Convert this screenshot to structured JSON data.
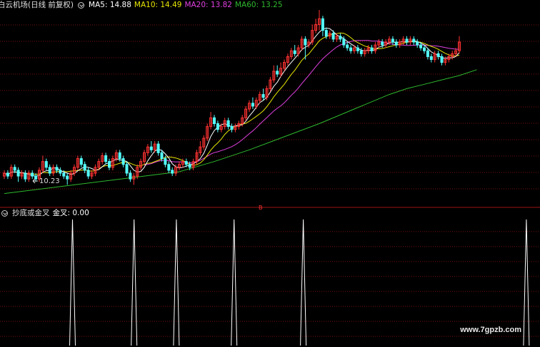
{
  "header": {
    "title": "白云机场(日线 前复权)",
    "ma5_label": "MA5: 14.88",
    "ma10_label": "MA10: 14.49",
    "ma20_label": "MA20: 13.82",
    "ma60_label": "MA60: 13.25"
  },
  "indicator": {
    "title": "抄底或金叉",
    "value_label": "金叉: 0.00"
  },
  "annotations": {
    "low_price": "10.23",
    "marker": "B"
  },
  "watermark": "www.7gpzb.com",
  "colors": {
    "background": "#000000",
    "grid": "#7a1010",
    "separator": "#a01414",
    "up_candle": "#ff3232",
    "down_candle": "#54ffff",
    "ma5": "#ffffff",
    "ma10": "#e6e600",
    "ma20": "#e040e0",
    "ma60": "#2eb82e",
    "signal": "#ffffff"
  },
  "chart_data": {
    "type": "candlestick",
    "price_range": [
      9.6,
      16.3
    ],
    "low_marker_price": 10.23,
    "candles": [
      [
        10.6,
        10.7,
        10.5,
        10.8
      ],
      [
        10.7,
        10.6,
        10.5,
        10.8
      ],
      [
        10.6,
        10.9,
        10.5,
        11.0
      ],
      [
        10.9,
        10.8,
        10.7,
        11.0
      ],
      [
        10.8,
        10.6,
        10.4,
        10.9
      ],
      [
        10.6,
        10.7,
        10.5,
        10.8
      ],
      [
        10.7,
        10.5,
        10.4,
        10.8
      ],
      [
        10.5,
        10.7,
        10.4,
        10.8
      ],
      [
        10.7,
        10.6,
        10.5,
        10.8
      ],
      [
        10.6,
        10.5,
        10.4,
        10.7
      ],
      [
        10.5,
        10.8,
        10.4,
        10.9
      ],
      [
        10.8,
        11.1,
        10.7,
        11.3
      ],
      [
        11.1,
        10.9,
        10.8,
        11.2
      ],
      [
        10.9,
        10.7,
        10.6,
        11.0
      ],
      [
        10.7,
        10.9,
        10.6,
        11.0
      ],
      [
        10.9,
        10.8,
        10.7,
        11.0
      ],
      [
        10.8,
        10.7,
        10.6,
        10.9
      ],
      [
        10.7,
        10.6,
        10.5,
        10.8
      ],
      [
        10.6,
        10.5,
        10.3,
        10.7
      ],
      [
        10.5,
        10.7,
        10.4,
        10.8
      ],
      [
        10.7,
        10.9,
        10.6,
        11.0
      ],
      [
        10.9,
        11.2,
        10.8,
        11.3
      ],
      [
        11.2,
        11.0,
        10.9,
        11.3
      ],
      [
        11.0,
        10.8,
        10.7,
        11.1
      ],
      [
        10.8,
        10.6,
        10.5,
        10.9
      ],
      [
        10.6,
        10.7,
        10.5,
        10.8
      ],
      [
        10.7,
        10.9,
        10.6,
        11.0
      ],
      [
        10.9,
        11.1,
        10.8,
        11.2
      ],
      [
        11.1,
        11.3,
        11.0,
        11.4
      ],
      [
        11.3,
        11.1,
        11.0,
        11.4
      ],
      [
        11.1,
        10.9,
        10.8,
        11.2
      ],
      [
        10.9,
        11.2,
        10.8,
        11.3
      ],
      [
        11.2,
        11.4,
        11.1,
        11.5
      ],
      [
        11.4,
        11.2,
        11.1,
        11.5
      ],
      [
        11.2,
        11.0,
        10.9,
        11.3
      ],
      [
        11.0,
        10.7,
        10.6,
        11.1
      ],
      [
        10.7,
        10.5,
        10.4,
        10.8
      ],
      [
        10.5,
        10.6,
        10.3,
        10.7
      ],
      [
        10.6,
        10.9,
        10.5,
        11.0
      ],
      [
        10.9,
        11.1,
        10.8,
        11.2
      ],
      [
        11.1,
        11.4,
        11.0,
        11.5
      ],
      [
        11.4,
        11.6,
        11.3,
        11.7
      ],
      [
        11.6,
        11.5,
        11.4,
        11.8
      ],
      [
        11.5,
        11.7,
        11.4,
        11.8
      ],
      [
        11.7,
        11.4,
        11.3,
        11.8
      ],
      [
        11.4,
        11.2,
        11.1,
        11.5
      ],
      [
        11.2,
        11.0,
        10.9,
        11.3
      ],
      [
        11.0,
        10.8,
        10.7,
        11.1
      ],
      [
        10.8,
        10.7,
        10.6,
        10.9
      ],
      [
        10.7,
        10.9,
        10.6,
        11.0
      ],
      [
        10.9,
        11.0,
        10.8,
        11.1
      ],
      [
        11.0,
        11.1,
        10.9,
        11.2
      ],
      [
        11.1,
        11.0,
        10.9,
        11.2
      ],
      [
        11.0,
        10.9,
        10.8,
        11.1
      ],
      [
        10.9,
        11.1,
        10.8,
        11.2
      ],
      [
        11.1,
        11.4,
        11.0,
        11.5
      ],
      [
        11.4,
        11.6,
        11.3,
        11.8
      ],
      [
        11.6,
        11.9,
        11.5,
        12.0
      ],
      [
        11.9,
        12.3,
        11.8,
        12.4
      ],
      [
        12.3,
        12.6,
        12.2,
        12.8
      ],
      [
        12.6,
        12.4,
        12.3,
        12.7
      ],
      [
        12.4,
        12.2,
        12.1,
        12.5
      ],
      [
        12.2,
        12.3,
        12.1,
        12.4
      ],
      [
        12.3,
        12.5,
        12.2,
        12.6
      ],
      [
        12.5,
        12.3,
        12.2,
        12.6
      ],
      [
        12.3,
        12.2,
        12.1,
        12.4
      ],
      [
        12.2,
        12.3,
        12.1,
        12.4
      ],
      [
        12.3,
        12.4,
        12.2,
        12.5
      ],
      [
        12.4,
        12.6,
        12.3,
        12.7
      ],
      [
        12.6,
        12.9,
        12.5,
        13.0
      ],
      [
        12.9,
        13.1,
        12.8,
        13.2
      ],
      [
        13.1,
        13.0,
        12.9,
        13.3
      ],
      [
        13.0,
        13.2,
        12.9,
        13.3
      ],
      [
        13.2,
        13.4,
        13.1,
        13.5
      ],
      [
        13.4,
        13.3,
        13.2,
        13.6
      ],
      [
        13.3,
        13.6,
        13.2,
        13.7
      ],
      [
        13.6,
        13.9,
        13.5,
        14.0
      ],
      [
        13.9,
        14.2,
        13.8,
        14.4
      ],
      [
        14.2,
        14.1,
        14.0,
        14.4
      ],
      [
        14.1,
        14.3,
        14.0,
        14.5
      ],
      [
        14.3,
        14.5,
        14.2,
        14.6
      ],
      [
        14.5,
        14.7,
        14.4,
        14.8
      ],
      [
        14.7,
        14.9,
        14.6,
        15.0
      ],
      [
        14.9,
        14.8,
        14.7,
        15.1
      ],
      [
        14.8,
        15.0,
        14.7,
        15.1
      ],
      [
        15.0,
        15.3,
        14.9,
        15.4
      ],
      [
        15.3,
        15.1,
        14.6,
        15.4
      ],
      [
        15.1,
        15.2,
        15.0,
        15.3
      ],
      [
        15.2,
        15.6,
        15.1,
        15.8
      ],
      [
        15.6,
        15.8,
        15.5,
        16.0
      ],
      [
        15.8,
        16.0,
        15.6,
        16.3
      ],
      [
        16.0,
        15.6,
        15.4,
        16.1
      ],
      [
        15.6,
        15.4,
        15.3,
        15.7
      ],
      [
        15.4,
        15.5,
        15.3,
        15.6
      ],
      [
        15.5,
        15.3,
        15.2,
        15.6
      ],
      [
        15.3,
        15.4,
        15.2,
        15.5
      ],
      [
        15.4,
        15.3,
        15.2,
        15.5
      ],
      [
        15.3,
        15.1,
        15.0,
        15.4
      ],
      [
        15.1,
        15.0,
        14.9,
        15.2
      ],
      [
        15.0,
        14.9,
        14.8,
        15.1
      ],
      [
        14.9,
        15.0,
        14.8,
        15.1
      ],
      [
        15.0,
        14.9,
        14.8,
        15.1
      ],
      [
        14.9,
        14.8,
        14.7,
        15.0
      ],
      [
        14.8,
        14.9,
        14.7,
        15.0
      ],
      [
        14.9,
        15.0,
        14.8,
        15.1
      ],
      [
        15.0,
        14.9,
        14.8,
        15.1
      ],
      [
        14.9,
        15.1,
        14.8,
        15.2
      ],
      [
        15.1,
        15.2,
        15.0,
        15.3
      ],
      [
        15.2,
        15.1,
        15.0,
        15.3
      ],
      [
        15.1,
        15.2,
        15.0,
        15.3
      ],
      [
        15.2,
        15.3,
        15.1,
        15.4
      ],
      [
        15.3,
        15.2,
        15.1,
        15.4
      ],
      [
        15.2,
        15.1,
        15.0,
        15.3
      ],
      [
        15.1,
        15.2,
        15.0,
        15.3
      ],
      [
        15.2,
        15.3,
        15.1,
        15.4
      ],
      [
        15.3,
        15.2,
        15.1,
        15.4
      ],
      [
        15.2,
        15.3,
        15.1,
        15.4
      ],
      [
        15.3,
        15.2,
        15.1,
        15.4
      ],
      [
        15.2,
        15.1,
        15.0,
        15.3
      ],
      [
        15.1,
        15.0,
        14.9,
        15.2
      ],
      [
        15.0,
        14.9,
        14.8,
        15.1
      ],
      [
        14.9,
        14.7,
        14.6,
        15.0
      ],
      [
        14.7,
        14.6,
        14.5,
        14.8
      ],
      [
        14.6,
        14.8,
        14.5,
        14.9
      ],
      [
        14.8,
        14.7,
        14.6,
        14.9
      ],
      [
        14.7,
        14.5,
        14.4,
        14.8
      ],
      [
        14.5,
        14.6,
        14.4,
        14.7
      ],
      [
        14.6,
        14.7,
        14.5,
        14.8
      ],
      [
        14.7,
        14.8,
        14.6,
        14.9
      ],
      [
        14.8,
        14.9,
        14.7,
        15.0
      ],
      [
        14.9,
        15.2,
        14.8,
        15.4
      ]
    ],
    "ma5_label_value": 14.88,
    "ma10_label_value": 14.49,
    "ma20_label_value": 13.82,
    "ma60_label_value": 13.25,
    "ma60_series": [
      [
        0,
        10.0
      ],
      [
        10,
        10.15
      ],
      [
        20,
        10.3
      ],
      [
        30,
        10.45
      ],
      [
        40,
        10.6
      ],
      [
        50,
        10.75
      ],
      [
        60,
        11.1
      ],
      [
        70,
        11.5
      ],
      [
        80,
        11.95
      ],
      [
        90,
        12.4
      ],
      [
        100,
        12.9
      ],
      [
        110,
        13.4
      ],
      [
        115,
        13.6
      ],
      [
        120,
        13.75
      ],
      [
        125,
        13.9
      ],
      [
        130,
        14.05
      ],
      [
        135,
        14.25
      ]
    ],
    "signal_type": "spike",
    "signal_range": [
      0,
      1
    ],
    "signal_spike_positions": [
      17,
      33,
      44,
      59,
      77,
      135,
      143,
      170
    ],
    "signal_partial_spike": {
      "position": 170,
      "bottom_level": 0.35
    }
  }
}
